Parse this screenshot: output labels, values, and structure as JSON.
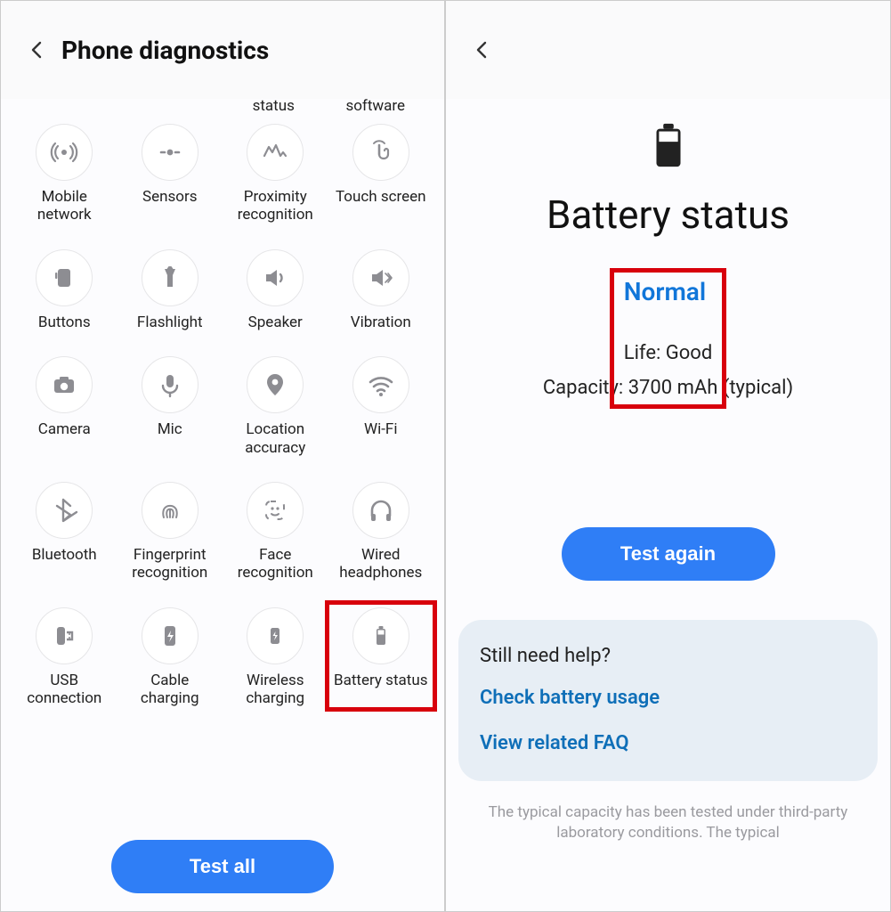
{
  "left": {
    "title": "Phone diagnostics",
    "fragments": {
      "a": "status",
      "b": "software"
    },
    "tiles": [
      {
        "key": "mobile-network",
        "label": "Mobile network",
        "icon": "antenna"
      },
      {
        "key": "sensors",
        "label": "Sensors",
        "icon": "sensors"
      },
      {
        "key": "proximity-recognition",
        "label": "Proximity recognition",
        "icon": "proximity"
      },
      {
        "key": "touch-screen",
        "label": "Touch screen",
        "icon": "touch"
      },
      {
        "key": "buttons",
        "label": "Buttons",
        "icon": "buttons"
      },
      {
        "key": "flashlight",
        "label": "Flashlight",
        "icon": "flashlight"
      },
      {
        "key": "speaker",
        "label": "Speaker",
        "icon": "speaker"
      },
      {
        "key": "vibration",
        "label": "Vibration",
        "icon": "vibration"
      },
      {
        "key": "camera",
        "label": "Camera",
        "icon": "camera"
      },
      {
        "key": "mic",
        "label": "Mic",
        "icon": "mic"
      },
      {
        "key": "location-accuracy",
        "label": "Location accuracy",
        "icon": "location"
      },
      {
        "key": "wifi",
        "label": "Wi-Fi",
        "icon": "wifi"
      },
      {
        "key": "bluetooth",
        "label": "Bluetooth",
        "icon": "bluetooth"
      },
      {
        "key": "fingerprint",
        "label": "Fingerprint recognition",
        "icon": "fingerprint"
      },
      {
        "key": "face-recognition",
        "label": "Face recognition",
        "icon": "face"
      },
      {
        "key": "wired-headphones",
        "label": "Wired headphones",
        "icon": "headphones"
      },
      {
        "key": "usb-connection",
        "label": "USB connection",
        "icon": "usb"
      },
      {
        "key": "cable-charging",
        "label": "Cable charging",
        "icon": "cable-charge"
      },
      {
        "key": "wireless-charging",
        "label": "Wireless charging",
        "icon": "wireless-charge"
      },
      {
        "key": "battery-status",
        "label": "Battery status",
        "icon": "battery",
        "highlight": true
      }
    ],
    "testAll": "Test all"
  },
  "right": {
    "title": "Battery status",
    "status": "Normal",
    "life": "Life: Good",
    "capacity": "Capacity: 3700 mAh (typical)",
    "testAgain": "Test again",
    "help": {
      "heading": "Still need help?",
      "link1": "Check battery usage",
      "link2": "View related FAQ"
    },
    "footnote": "The typical capacity has been tested under third-party laboratory conditions. The typical"
  }
}
